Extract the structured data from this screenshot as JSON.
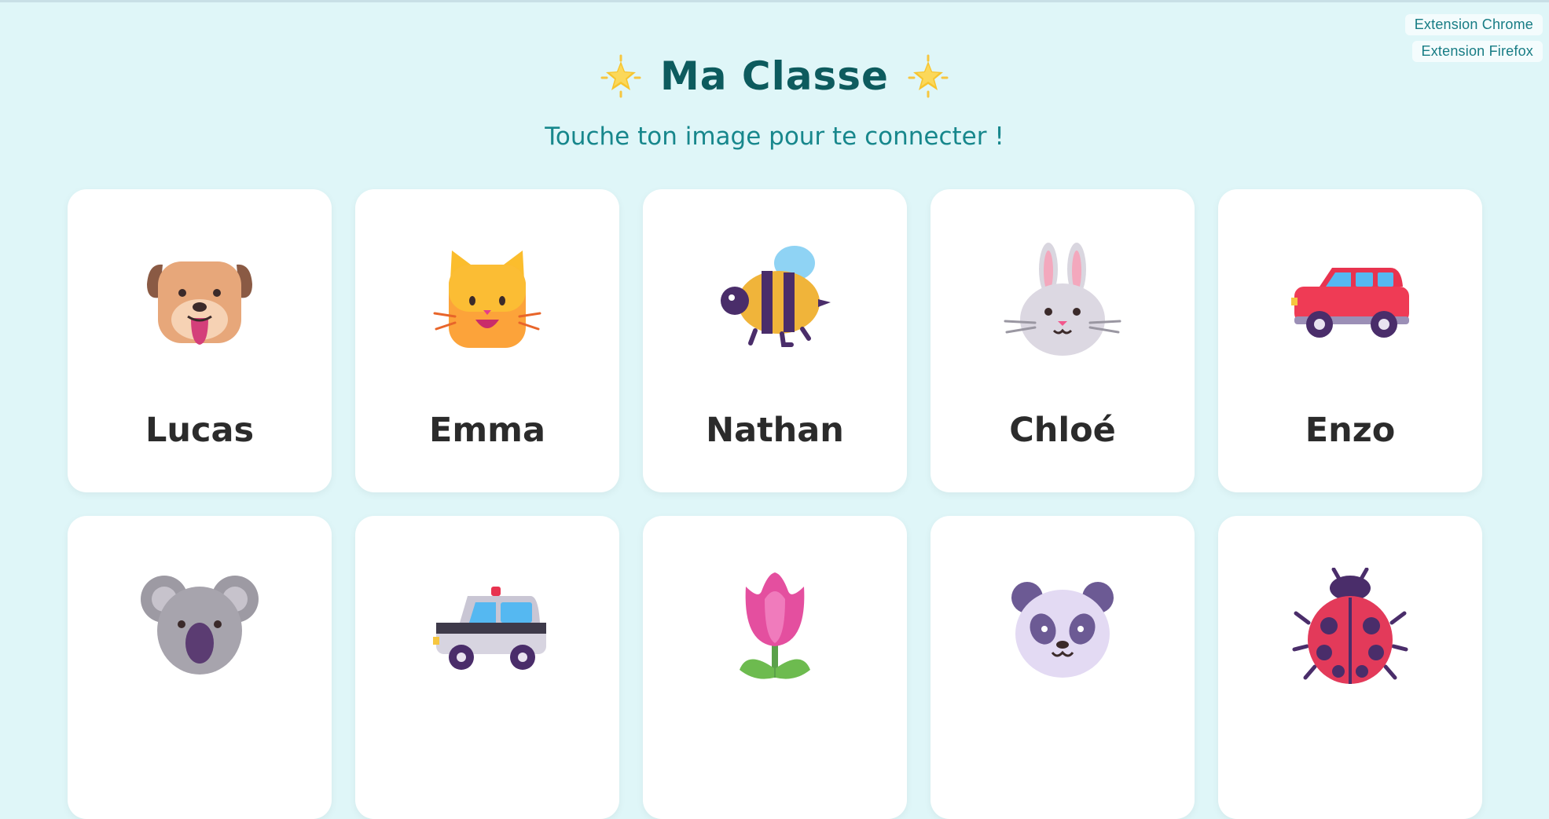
{
  "extensions": {
    "chrome": "Extension Chrome",
    "firefox": "Extension Firefox"
  },
  "header": {
    "title": "Ma Classe",
    "subtitle": "Touche ton image pour te connecter !"
  },
  "students": [
    {
      "name": "Lucas",
      "icon": "dog-face-icon"
    },
    {
      "name": "Emma",
      "icon": "cat-face-icon"
    },
    {
      "name": "Nathan",
      "icon": "bee-icon"
    },
    {
      "name": "Chloé",
      "icon": "rabbit-face-icon"
    },
    {
      "name": "Enzo",
      "icon": "car-icon"
    },
    {
      "name": "",
      "icon": "koala-icon"
    },
    {
      "name": "",
      "icon": "police-car-icon"
    },
    {
      "name": "",
      "icon": "tulip-icon"
    },
    {
      "name": "",
      "icon": "panda-icon"
    },
    {
      "name": "",
      "icon": "ladybug-icon"
    }
  ],
  "colors": {
    "background": "#dff6f8",
    "title": "#0d5b5e",
    "subtitle": "#17878c",
    "card": "#ffffff"
  }
}
